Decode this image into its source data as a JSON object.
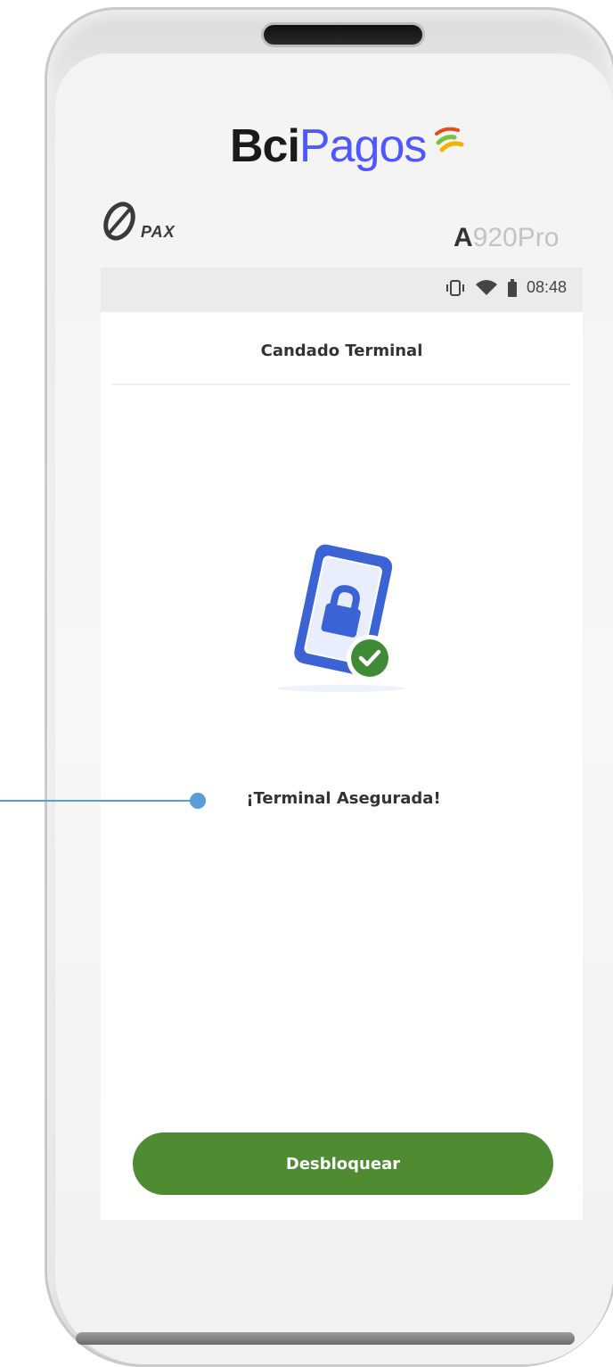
{
  "device": {
    "brand_bci": "Bci",
    "brand_pagos": "Pagos",
    "pax_label": "PAX",
    "model_prefix": "A",
    "model_suffix": "920Pro"
  },
  "statusbar": {
    "time": "08:48",
    "icons": [
      "vibrate-icon",
      "wifi-icon",
      "battery-icon"
    ]
  },
  "screen": {
    "title": "Candado Terminal",
    "illustration": "phone-lock-check-icon",
    "message": "¡Terminal Asegurada!",
    "button_label": "Desbloquear"
  },
  "colors": {
    "button": "#4f8b32",
    "callout": "#5b9bd8",
    "phone_blue": "#3b63d6",
    "brand_blue": "#4f57ff"
  }
}
